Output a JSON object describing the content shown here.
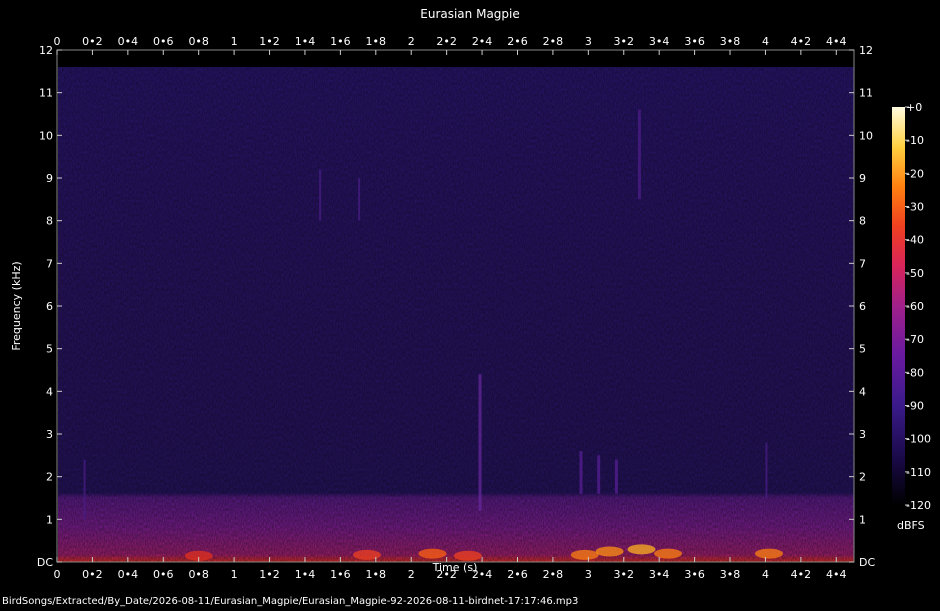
{
  "chart_data": {
    "type": "heatmap",
    "title": "Eurasian Magpie",
    "xlabel": "Time (s)",
    "ylabel": "Frequency (kHz)",
    "xlim": [
      0,
      4.5
    ],
    "ylim": [
      0,
      12
    ],
    "x_ticks": [
      "0",
      "0•2",
      "0•4",
      "0•6",
      "0•8",
      "1",
      "1•2",
      "1•4",
      "1•6",
      "1•8",
      "2",
      "2•2",
      "2•4",
      "2•6",
      "2•8",
      "3",
      "3•2",
      "3•4",
      "3•6",
      "3•8",
      "4",
      "4•2",
      "4•4"
    ],
    "x_tick_values": [
      0,
      0.2,
      0.4,
      0.6,
      0.8,
      1.0,
      1.2,
      1.4,
      1.6,
      1.8,
      2.0,
      2.2,
      2.4,
      2.6,
      2.8,
      3.0,
      3.2,
      3.4,
      3.6,
      3.8,
      4.0,
      4.2,
      4.4
    ],
    "y_ticks": [
      "DC",
      "1",
      "2",
      "3",
      "4",
      "5",
      "6",
      "7",
      "8",
      "9",
      "10",
      "11",
      "12"
    ],
    "y_tick_values": [
      0,
      1,
      2,
      3,
      4,
      5,
      6,
      7,
      8,
      9,
      10,
      11,
      12
    ],
    "colorbar": {
      "label": "dBFS",
      "range": [
        -120,
        0
      ],
      "ticks": [
        "+0",
        "-10",
        "-20",
        "-30",
        "-40",
        "-50",
        "-60",
        "-70",
        "-80",
        "-90",
        "-100",
        "-110",
        "-120"
      ],
      "tick_values": [
        0,
        -10,
        -20,
        -30,
        -40,
        -50,
        -60,
        -70,
        -80,
        -90,
        -100,
        -110,
        -120
      ],
      "colors": [
        "#000000",
        "#1a0a4a",
        "#3a1a8a",
        "#6a1aa0",
        "#a0208a",
        "#d8245a",
        "#f04020",
        "#ff8010",
        "#ffd040",
        "#fffbe0"
      ]
    },
    "signal_bands": [
      {
        "f_min": 0,
        "f_max": 1.6,
        "level_dbfs": -78
      },
      {
        "f_min": 0,
        "f_max": 0.15,
        "level_dbfs": -55
      },
      {
        "f_min": 1.6,
        "f_max": 11.6,
        "level_dbfs": -100
      }
    ],
    "grid": false
  },
  "footer": {
    "path": "BirdSongs/Extracted/By_Date/2026-08-11/Eurasian_Magpie/Eurasian_Magpie-92-2026-08-11-birdnet-17:17:46.mp3"
  }
}
